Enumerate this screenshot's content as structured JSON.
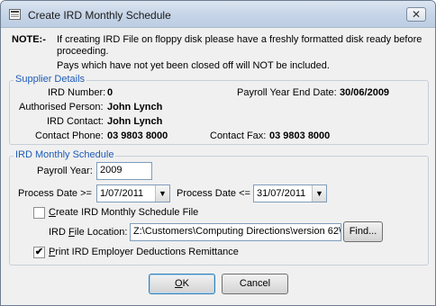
{
  "window": {
    "title": "Create IRD Monthly Schedule",
    "close_glyph": "✕"
  },
  "notes": {
    "label": "NOTE:-",
    "line1a": "If creating IRD File on floppy disk please have a freshly formatted disk ready before",
    "line1b": "proceeding.",
    "line2": "Pays which have not yet been closed off will NOT be included."
  },
  "supplier": {
    "legend": "Supplier Details",
    "ird_number_label": "IRD Number:",
    "ird_number": "0",
    "year_end_label": "Payroll Year End Date:",
    "year_end": "30/06/2009",
    "auth_person_label": "Authorised Person:",
    "auth_person": "John Lynch",
    "ird_contact_label": "IRD Contact:",
    "ird_contact": "John Lynch",
    "phone_label": "Contact Phone:",
    "phone": "03 9803 8000",
    "fax_label": "Contact Fax:",
    "fax": "03 9803 8000"
  },
  "schedule": {
    "legend": "IRD Monthly Schedule",
    "payroll_year_label": "Payroll Year:",
    "payroll_year": "2009",
    "date_from_label": "Process Date >=",
    "date_from": "1/07/2011",
    "date_to_label": "Process Date <=",
    "date_to": "31/07/2011",
    "create_file_label_pre": "",
    "create_file_label_u": "C",
    "create_file_label_post": "reate IRD Monthly Schedule File",
    "create_file_checked": false,
    "file_location_label_pre": "IRD ",
    "file_location_label_u": "F",
    "file_location_label_post": "ile Location:",
    "file_location": "Z:\\Customers\\Computing Directions\\version 62\\",
    "find_label": "Find...",
    "print_label_pre": "",
    "print_label_u": "P",
    "print_label_post": "rint IRD Employer Deductions Remittance",
    "print_checked": true
  },
  "buttons": {
    "ok_u": "O",
    "ok_post": "K",
    "cancel": "Cancel"
  },
  "icons": {
    "dropdown": "▼",
    "check": "✔"
  }
}
